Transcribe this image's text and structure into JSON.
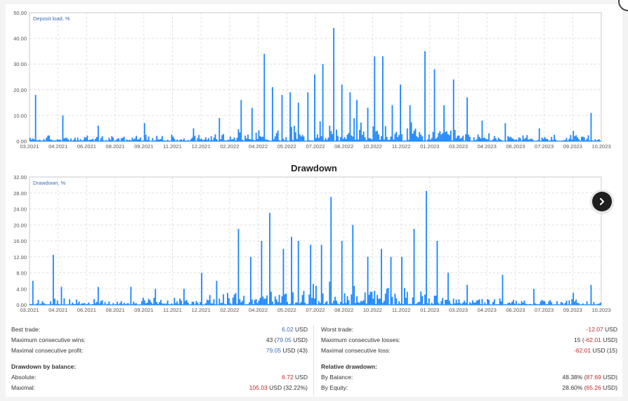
{
  "chart_data": [
    {
      "type": "bar",
      "title": "",
      "legend": "Deposit load, %",
      "ylim": [
        0,
        50
      ],
      "y_ticks": [
        "0.00",
        "10.00",
        "20.00",
        "30.00",
        "40.00",
        "50.00"
      ],
      "x_ticks": [
        "03.2021",
        "04.2021",
        "06.2021",
        "08.2021",
        "09.2021",
        "11.2021",
        "12.2021",
        "02.2022",
        "04.2022",
        "05.2022",
        "07.2022",
        "08.2022",
        "10.2022",
        "11.2022",
        "01.2023",
        "03.2023",
        "04.2023",
        "06.2023",
        "07.2023",
        "09.2023",
        "10.2023"
      ],
      "peaks": [
        {
          "t": 0.01,
          "v": 18
        },
        {
          "t": 0.058,
          "v": 10
        },
        {
          "t": 0.12,
          "v": 6
        },
        {
          "t": 0.2,
          "v": 7
        },
        {
          "t": 0.285,
          "v": 5
        },
        {
          "t": 0.33,
          "v": 9
        },
        {
          "t": 0.37,
          "v": 16
        },
        {
          "t": 0.387,
          "v": 13
        },
        {
          "t": 0.41,
          "v": 34
        },
        {
          "t": 0.423,
          "v": 21
        },
        {
          "t": 0.44,
          "v": 18
        },
        {
          "t": 0.455,
          "v": 19
        },
        {
          "t": 0.468,
          "v": 15
        },
        {
          "t": 0.486,
          "v": 19
        },
        {
          "t": 0.497,
          "v": 26
        },
        {
          "t": 0.512,
          "v": 30
        },
        {
          "t": 0.53,
          "v": 44
        },
        {
          "t": 0.545,
          "v": 22
        },
        {
          "t": 0.56,
          "v": 19
        },
        {
          "t": 0.572,
          "v": 16
        },
        {
          "t": 0.59,
          "v": 13
        },
        {
          "t": 0.602,
          "v": 33
        },
        {
          "t": 0.616,
          "v": 33
        },
        {
          "t": 0.634,
          "v": 14
        },
        {
          "t": 0.648,
          "v": 22
        },
        {
          "t": 0.665,
          "v": 14
        },
        {
          "t": 0.69,
          "v": 35
        },
        {
          "t": 0.708,
          "v": 28
        },
        {
          "t": 0.723,
          "v": 14
        },
        {
          "t": 0.74,
          "v": 24
        },
        {
          "t": 0.765,
          "v": 17
        },
        {
          "t": 0.79,
          "v": 8
        },
        {
          "t": 0.83,
          "v": 7
        },
        {
          "t": 0.89,
          "v": 5
        },
        {
          "t": 0.95,
          "v": 4
        },
        {
          "t": 0.98,
          "v": 11
        }
      ]
    },
    {
      "type": "bar",
      "title": "Drawdown",
      "legend": "Drawdown, %",
      "ylim": [
        0,
        32
      ],
      "y_ticks": [
        "0.00",
        "4.00",
        "8.00",
        "12.00",
        "16.00",
        "20.00",
        "24.00",
        "28.00",
        "32.00"
      ],
      "x_ticks": [
        "03.2021",
        "04.2021",
        "06.2021",
        "08.2021",
        "09.2021",
        "11.2021",
        "12.2021",
        "02.2022",
        "04.2022",
        "05.2022",
        "07.2022",
        "08.2022",
        "10.2022",
        "11.2022",
        "01.2023",
        "03.2023",
        "04.2023",
        "06.2023",
        "07.2023",
        "09.2023",
        "10.2023"
      ],
      "peaks": [
        {
          "t": 0.004,
          "v": 6
        },
        {
          "t": 0.04,
          "v": 12.5
        },
        {
          "t": 0.055,
          "v": 4.5
        },
        {
          "t": 0.12,
          "v": 4.5
        },
        {
          "t": 0.175,
          "v": 4.5
        },
        {
          "t": 0.22,
          "v": 4
        },
        {
          "t": 0.27,
          "v": 4
        },
        {
          "t": 0.3,
          "v": 8
        },
        {
          "t": 0.325,
          "v": 6
        },
        {
          "t": 0.365,
          "v": 19
        },
        {
          "t": 0.385,
          "v": 12
        },
        {
          "t": 0.405,
          "v": 16
        },
        {
          "t": 0.42,
          "v": 23
        },
        {
          "t": 0.443,
          "v": 14
        },
        {
          "t": 0.456,
          "v": 17
        },
        {
          "t": 0.47,
          "v": 16
        },
        {
          "t": 0.49,
          "v": 15
        },
        {
          "t": 0.51,
          "v": 15
        },
        {
          "t": 0.527,
          "v": 27
        },
        {
          "t": 0.545,
          "v": 16
        },
        {
          "t": 0.565,
          "v": 20
        },
        {
          "t": 0.59,
          "v": 12
        },
        {
          "t": 0.615,
          "v": 14
        },
        {
          "t": 0.632,
          "v": 12
        },
        {
          "t": 0.65,
          "v": 12
        },
        {
          "t": 0.671,
          "v": 19
        },
        {
          "t": 0.692,
          "v": 28.5
        },
        {
          "t": 0.713,
          "v": 16
        },
        {
          "t": 0.73,
          "v": 8
        },
        {
          "t": 0.765,
          "v": 5
        },
        {
          "t": 0.825,
          "v": 7.5
        },
        {
          "t": 0.88,
          "v": 4
        },
        {
          "t": 0.95,
          "v": 3
        },
        {
          "t": 0.98,
          "v": 5
        }
      ]
    }
  ],
  "stats_left": {
    "best_trade_label": "Best trade:",
    "best_trade_value": "6.02",
    "best_trade_unit": "USD",
    "max_consec_wins_label": "Maximum consecutive wins:",
    "max_consec_wins_count": "43",
    "max_consec_wins_amount": "79.05",
    "max_consec_wins_unit": "USD",
    "max_consec_profit_label": "Maximal consecutive profit:",
    "max_consec_profit_value": "79.05",
    "max_consec_profit_unit": "USD",
    "max_consec_profit_count": "43",
    "dd_balance_head": "Drawdown by balance:",
    "absolute_label": "Absolute:",
    "absolute_value": "6.72",
    "absolute_unit": "USD",
    "maximal_label": "Maximal:",
    "maximal_value": "105.03",
    "maximal_unit": "USD",
    "maximal_pct": "32.22%"
  },
  "stats_right": {
    "worst_trade_label": "Worst trade:",
    "worst_trade_value": "-12.07",
    "worst_trade_unit": "USD",
    "max_consec_losses_label": "Maximum consecutive losses:",
    "max_consec_losses_count": "15",
    "max_consec_losses_amount": "-62.01",
    "max_consec_losses_unit": "USD",
    "max_consec_loss_label": "Maximal consecutive loss:",
    "max_consec_loss_value": "-62.01",
    "max_consec_loss_unit": "USD",
    "max_consec_loss_count": "15",
    "rel_dd_head": "Relative drawdown:",
    "by_balance_label": "By Balance:",
    "by_balance_pct": "48.38%",
    "by_balance_amount": "87.69",
    "by_balance_unit": "USD",
    "by_equity_label": "By Equity:",
    "by_equity_pct": "28.60%",
    "by_equity_amount": "65.26",
    "by_equity_unit": "USD"
  },
  "colors": {
    "bar": "#1e88ff",
    "accent_blue": "#3a6fb5",
    "negative_red": "#c0282a",
    "grid": "#d8d8d8"
  },
  "icons": {
    "nav": "chevron-right-icon"
  }
}
